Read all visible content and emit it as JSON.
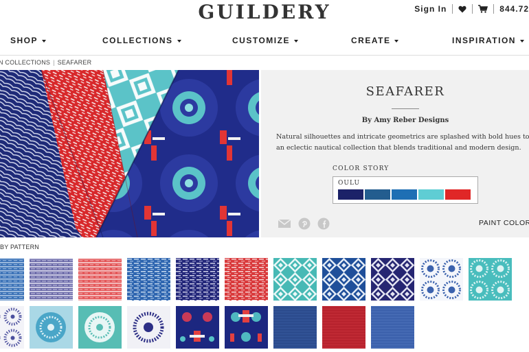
{
  "header": {
    "logo": "GUILDERY",
    "sign_in": "Sign In",
    "phone": "844.72"
  },
  "nav": {
    "items": [
      {
        "label": "SHOP"
      },
      {
        "label": "COLLECTIONS"
      },
      {
        "label": "CUSTOMIZE"
      },
      {
        "label": "CREATE"
      },
      {
        "label": "INSPIRATION"
      }
    ]
  },
  "breadcrumb": {
    "parent": "N COLLECTIONS",
    "current": "SEAFARER"
  },
  "collection": {
    "title": "SEAFARER",
    "author": "By Amy Reber Designs",
    "description_line1": "Natural silhouettes and intricate geometrics are splashed with bold hues to creat",
    "description_line2": "an eclectic nautical collection that blends traditional and modern design.",
    "color_story_label": "COLOR STORY",
    "color_story_name": "OULU",
    "swatches": [
      "#1c2268",
      "#235d8f",
      "#1e6fb4",
      "#5fcdd4",
      "#e02727"
    ],
    "paint_label": "PAINT COLOR"
  },
  "patterns": {
    "section_label": "BY PATTERN"
  }
}
